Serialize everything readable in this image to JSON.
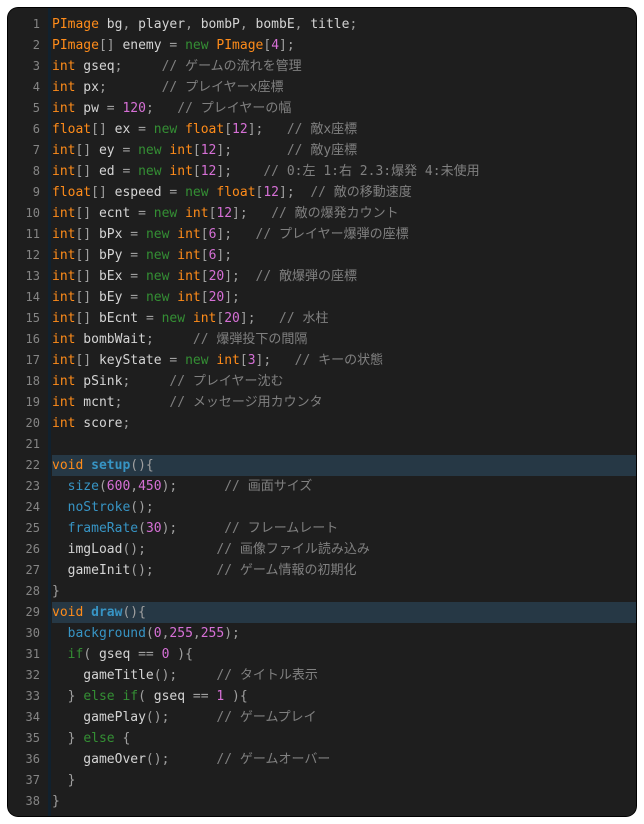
{
  "editor": {
    "active_lines": [
      22,
      29
    ],
    "lines": [
      {
        "n": 1,
        "tokens": [
          [
            "type",
            "PImage"
          ],
          [
            "ident",
            " bg"
          ],
          [
            "op",
            ","
          ],
          [
            "ident",
            " player"
          ],
          [
            "op",
            ","
          ],
          [
            "ident",
            " bombP"
          ],
          [
            "op",
            ","
          ],
          [
            "ident",
            " bombE"
          ],
          [
            "op",
            ","
          ],
          [
            "ident",
            " title"
          ],
          [
            "op",
            ";"
          ]
        ]
      },
      {
        "n": 2,
        "tokens": [
          [
            "type",
            "PImage"
          ],
          [
            "op",
            "[]"
          ],
          [
            "ident",
            " enemy "
          ],
          [
            "op",
            "= "
          ],
          [
            "keyword",
            "new"
          ],
          [
            "ident",
            " "
          ],
          [
            "type",
            "PImage"
          ],
          [
            "op",
            "["
          ],
          [
            "num",
            "4"
          ],
          [
            "op",
            "];"
          ]
        ]
      },
      {
        "n": 3,
        "tokens": [
          [
            "type",
            "int"
          ],
          [
            "ident",
            " gseq"
          ],
          [
            "op",
            ";     "
          ],
          [
            "comment",
            "// ゲームの流れを管理"
          ]
        ]
      },
      {
        "n": 4,
        "tokens": [
          [
            "type",
            "int"
          ],
          [
            "ident",
            " px"
          ],
          [
            "op",
            ";       "
          ],
          [
            "comment",
            "// プレイヤーx座標"
          ]
        ]
      },
      {
        "n": 5,
        "tokens": [
          [
            "type",
            "int"
          ],
          [
            "ident",
            " pw "
          ],
          [
            "op",
            "= "
          ],
          [
            "num",
            "120"
          ],
          [
            "op",
            ";   "
          ],
          [
            "comment",
            "// プレイヤーの幅"
          ]
        ]
      },
      {
        "n": 6,
        "tokens": [
          [
            "type",
            "float"
          ],
          [
            "op",
            "[]"
          ],
          [
            "ident",
            " ex "
          ],
          [
            "op",
            "= "
          ],
          [
            "keyword",
            "new"
          ],
          [
            "ident",
            " "
          ],
          [
            "type",
            "float"
          ],
          [
            "op",
            "["
          ],
          [
            "num",
            "12"
          ],
          [
            "op",
            "];   "
          ],
          [
            "comment",
            "// 敵x座標"
          ]
        ]
      },
      {
        "n": 7,
        "tokens": [
          [
            "type",
            "int"
          ],
          [
            "op",
            "[]"
          ],
          [
            "ident",
            " ey "
          ],
          [
            "op",
            "= "
          ],
          [
            "keyword",
            "new"
          ],
          [
            "ident",
            " "
          ],
          [
            "type",
            "int"
          ],
          [
            "op",
            "["
          ],
          [
            "num",
            "12"
          ],
          [
            "op",
            "];       "
          ],
          [
            "comment",
            "// 敵y座標"
          ]
        ]
      },
      {
        "n": 8,
        "tokens": [
          [
            "type",
            "int"
          ],
          [
            "op",
            "[]"
          ],
          [
            "ident",
            " ed "
          ],
          [
            "op",
            "= "
          ],
          [
            "keyword",
            "new"
          ],
          [
            "ident",
            " "
          ],
          [
            "type",
            "int"
          ],
          [
            "op",
            "["
          ],
          [
            "num",
            "12"
          ],
          [
            "op",
            "];    "
          ],
          [
            "comment",
            "// 0:左 1:右 2.3:爆発 4:未使用"
          ]
        ]
      },
      {
        "n": 9,
        "tokens": [
          [
            "type",
            "float"
          ],
          [
            "op",
            "[]"
          ],
          [
            "ident",
            " espeed "
          ],
          [
            "op",
            "= "
          ],
          [
            "keyword",
            "new"
          ],
          [
            "ident",
            " "
          ],
          [
            "type",
            "float"
          ],
          [
            "op",
            "["
          ],
          [
            "num",
            "12"
          ],
          [
            "op",
            "];  "
          ],
          [
            "comment",
            "// 敵の移動速度"
          ]
        ]
      },
      {
        "n": 10,
        "tokens": [
          [
            "type",
            "int"
          ],
          [
            "op",
            "[]"
          ],
          [
            "ident",
            " ecnt "
          ],
          [
            "op",
            "= "
          ],
          [
            "keyword",
            "new"
          ],
          [
            "ident",
            " "
          ],
          [
            "type",
            "int"
          ],
          [
            "op",
            "["
          ],
          [
            "num",
            "12"
          ],
          [
            "op",
            "];   "
          ],
          [
            "comment",
            "// 敵の爆発カウント"
          ]
        ]
      },
      {
        "n": 11,
        "tokens": [
          [
            "type",
            "int"
          ],
          [
            "op",
            "[]"
          ],
          [
            "ident",
            " bPx "
          ],
          [
            "op",
            "= "
          ],
          [
            "keyword",
            "new"
          ],
          [
            "ident",
            " "
          ],
          [
            "type",
            "int"
          ],
          [
            "op",
            "["
          ],
          [
            "num",
            "6"
          ],
          [
            "op",
            "];   "
          ],
          [
            "comment",
            "// プレイヤー爆弾の座標"
          ]
        ]
      },
      {
        "n": 12,
        "tokens": [
          [
            "type",
            "int"
          ],
          [
            "op",
            "[]"
          ],
          [
            "ident",
            " bPy "
          ],
          [
            "op",
            "= "
          ],
          [
            "keyword",
            "new"
          ],
          [
            "ident",
            " "
          ],
          [
            "type",
            "int"
          ],
          [
            "op",
            "["
          ],
          [
            "num",
            "6"
          ],
          [
            "op",
            "];"
          ]
        ]
      },
      {
        "n": 13,
        "tokens": [
          [
            "type",
            "int"
          ],
          [
            "op",
            "[]"
          ],
          [
            "ident",
            " bEx "
          ],
          [
            "op",
            "= "
          ],
          [
            "keyword",
            "new"
          ],
          [
            "ident",
            " "
          ],
          [
            "type",
            "int"
          ],
          [
            "op",
            "["
          ],
          [
            "num",
            "20"
          ],
          [
            "op",
            "];  "
          ],
          [
            "comment",
            "// 敵爆弾の座標"
          ]
        ]
      },
      {
        "n": 14,
        "tokens": [
          [
            "type",
            "int"
          ],
          [
            "op",
            "[]"
          ],
          [
            "ident",
            " bEy "
          ],
          [
            "op",
            "= "
          ],
          [
            "keyword",
            "new"
          ],
          [
            "ident",
            " "
          ],
          [
            "type",
            "int"
          ],
          [
            "op",
            "["
          ],
          [
            "num",
            "20"
          ],
          [
            "op",
            "];"
          ]
        ]
      },
      {
        "n": 15,
        "tokens": [
          [
            "type",
            "int"
          ],
          [
            "op",
            "[]"
          ],
          [
            "ident",
            " bEcnt "
          ],
          [
            "op",
            "= "
          ],
          [
            "keyword",
            "new"
          ],
          [
            "ident",
            " "
          ],
          [
            "type",
            "int"
          ],
          [
            "op",
            "["
          ],
          [
            "num",
            "20"
          ],
          [
            "op",
            "];   "
          ],
          [
            "comment",
            "// 水柱"
          ]
        ]
      },
      {
        "n": 16,
        "tokens": [
          [
            "type",
            "int"
          ],
          [
            "ident",
            " bombWait"
          ],
          [
            "op",
            ";     "
          ],
          [
            "comment",
            "// 爆弾投下の間隔"
          ]
        ]
      },
      {
        "n": 17,
        "tokens": [
          [
            "type",
            "int"
          ],
          [
            "op",
            "[]"
          ],
          [
            "ident",
            " keyState "
          ],
          [
            "op",
            "= "
          ],
          [
            "keyword",
            "new"
          ],
          [
            "ident",
            " "
          ],
          [
            "type",
            "int"
          ],
          [
            "op",
            "["
          ],
          [
            "num",
            "3"
          ],
          [
            "op",
            "];   "
          ],
          [
            "comment",
            "// キーの状態"
          ]
        ]
      },
      {
        "n": 18,
        "tokens": [
          [
            "type",
            "int"
          ],
          [
            "ident",
            " pSink"
          ],
          [
            "op",
            ";     "
          ],
          [
            "comment",
            "// プレイヤー沈む"
          ]
        ]
      },
      {
        "n": 19,
        "tokens": [
          [
            "type",
            "int"
          ],
          [
            "ident",
            " mcnt"
          ],
          [
            "op",
            ";      "
          ],
          [
            "comment",
            "// メッセージ用カウンタ"
          ]
        ]
      },
      {
        "n": 20,
        "tokens": [
          [
            "type",
            "int"
          ],
          [
            "ident",
            " score"
          ],
          [
            "op",
            ";"
          ]
        ]
      },
      {
        "n": 21,
        "tokens": []
      },
      {
        "n": 22,
        "tokens": [
          [
            "type",
            "void"
          ],
          [
            "ident",
            " "
          ],
          [
            "func",
            "setup"
          ],
          [
            "op",
            "(){"
          ]
        ]
      },
      {
        "n": 23,
        "tokens": [
          [
            "ident",
            "  "
          ],
          [
            "call",
            "size"
          ],
          [
            "op",
            "("
          ],
          [
            "num",
            "600"
          ],
          [
            "op",
            ","
          ],
          [
            "num",
            "450"
          ],
          [
            "op",
            ");      "
          ],
          [
            "comment",
            "// 画面サイズ"
          ]
        ]
      },
      {
        "n": 24,
        "tokens": [
          [
            "ident",
            "  "
          ],
          [
            "call",
            "noStroke"
          ],
          [
            "op",
            "();"
          ]
        ]
      },
      {
        "n": 25,
        "tokens": [
          [
            "ident",
            "  "
          ],
          [
            "call",
            "frameRate"
          ],
          [
            "op",
            "("
          ],
          [
            "num",
            "30"
          ],
          [
            "op",
            ");      "
          ],
          [
            "comment",
            "// フレームレート"
          ]
        ]
      },
      {
        "n": 26,
        "tokens": [
          [
            "ident",
            "  imgLoad"
          ],
          [
            "op",
            "();         "
          ],
          [
            "comment",
            "// 画像ファイル読み込み"
          ]
        ]
      },
      {
        "n": 27,
        "tokens": [
          [
            "ident",
            "  gameInit"
          ],
          [
            "op",
            "();        "
          ],
          [
            "comment",
            "// ゲーム情報の初期化"
          ]
        ]
      },
      {
        "n": 28,
        "tokens": [
          [
            "op",
            "}"
          ]
        ]
      },
      {
        "n": 29,
        "tokens": [
          [
            "type",
            "void"
          ],
          [
            "ident",
            " "
          ],
          [
            "func",
            "draw"
          ],
          [
            "op",
            "(){"
          ]
        ]
      },
      {
        "n": 30,
        "tokens": [
          [
            "ident",
            "  "
          ],
          [
            "call",
            "background"
          ],
          [
            "op",
            "("
          ],
          [
            "num",
            "0"
          ],
          [
            "op",
            ","
          ],
          [
            "num",
            "255"
          ],
          [
            "op",
            ","
          ],
          [
            "num",
            "255"
          ],
          [
            "op",
            ");"
          ]
        ]
      },
      {
        "n": 31,
        "tokens": [
          [
            "ident",
            "  "
          ],
          [
            "keyword",
            "if"
          ],
          [
            "op",
            "("
          ],
          [
            "ident",
            " gseq "
          ],
          [
            "op",
            "== "
          ],
          [
            "num",
            "0"
          ],
          [
            "ident",
            " "
          ],
          [
            "op",
            "){"
          ]
        ]
      },
      {
        "n": 32,
        "tokens": [
          [
            "ident",
            "    gameTitle"
          ],
          [
            "op",
            "();     "
          ],
          [
            "comment",
            "// タイトル表示"
          ]
        ]
      },
      {
        "n": 33,
        "tokens": [
          [
            "ident",
            "  "
          ],
          [
            "op",
            "} "
          ],
          [
            "keyword",
            "else"
          ],
          [
            "ident",
            " "
          ],
          [
            "keyword",
            "if"
          ],
          [
            "op",
            "("
          ],
          [
            "ident",
            " gseq "
          ],
          [
            "op",
            "== "
          ],
          [
            "num",
            "1"
          ],
          [
            "ident",
            " "
          ],
          [
            "op",
            "){"
          ]
        ]
      },
      {
        "n": 34,
        "tokens": [
          [
            "ident",
            "    gamePlay"
          ],
          [
            "op",
            "();      "
          ],
          [
            "comment",
            "// ゲームプレイ"
          ]
        ]
      },
      {
        "n": 35,
        "tokens": [
          [
            "ident",
            "  "
          ],
          [
            "op",
            "} "
          ],
          [
            "keyword",
            "else"
          ],
          [
            "ident",
            " "
          ],
          [
            "op",
            "{"
          ]
        ]
      },
      {
        "n": 36,
        "tokens": [
          [
            "ident",
            "    gameOver"
          ],
          [
            "op",
            "();      "
          ],
          [
            "comment",
            "// ゲームオーバー"
          ]
        ]
      },
      {
        "n": 37,
        "tokens": [
          [
            "ident",
            "  "
          ],
          [
            "op",
            "}"
          ]
        ]
      },
      {
        "n": 38,
        "tokens": [
          [
            "op",
            "}"
          ]
        ]
      }
    ]
  }
}
